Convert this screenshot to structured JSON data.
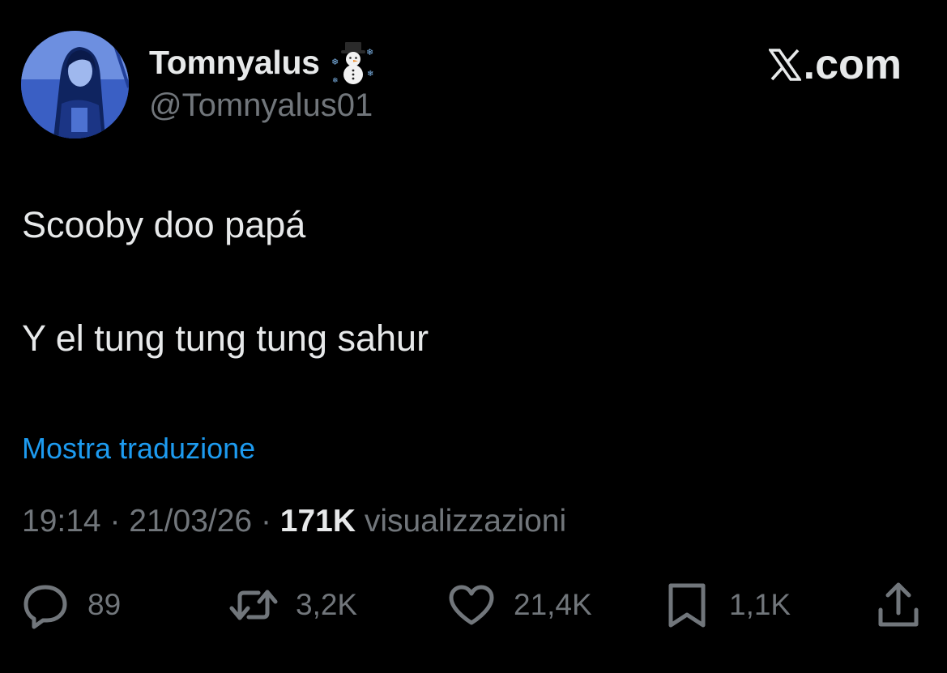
{
  "author": {
    "display_name": "Tomnyalus",
    "handle": "@Tomnyalus01",
    "name_emoji": "snowman-icon"
  },
  "site": {
    "label": ".com",
    "logo": "x-logo-icon"
  },
  "tweet": {
    "lines": [
      "Scooby doo papá",
      "Y el tung tung tung sahur"
    ],
    "translate_label": "Mostra traduzione",
    "time": "19:14",
    "date": "21/03/26",
    "views_count": "171K",
    "views_label": "visualizzazioni",
    "separator": "·"
  },
  "actions": {
    "reply": {
      "icon": "reply-icon",
      "count": "89"
    },
    "retweet": {
      "icon": "retweet-icon",
      "count": "3,2K"
    },
    "like": {
      "icon": "heart-icon",
      "count": "21,4K"
    },
    "bookmark": {
      "icon": "bookmark-icon",
      "count": "1,1K"
    },
    "share": {
      "icon": "share-icon"
    }
  },
  "colors": {
    "background": "#000000",
    "text_primary": "#e7e9ea",
    "text_secondary": "#71767b",
    "link": "#1d9bf0",
    "avatar_tint": "#2d4fb0"
  }
}
